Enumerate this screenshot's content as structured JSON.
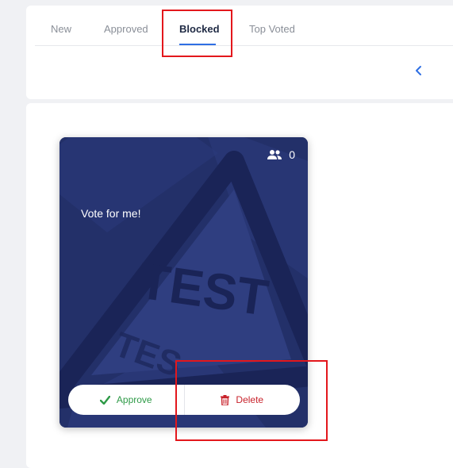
{
  "tabs": [
    {
      "label": "New"
    },
    {
      "label": "Approved"
    },
    {
      "label": "Blocked",
      "active": true
    },
    {
      "label": "Top Voted"
    }
  ],
  "pager": {
    "prev_icon": "chevron-left-icon"
  },
  "card": {
    "voter_count": "0",
    "voter_icon": "people-icon",
    "title": "Vote for me!",
    "image_text": "TEST",
    "approve_label": "Approve",
    "delete_label": "Delete"
  },
  "colors": {
    "accent": "#2f6fe4",
    "approve": "#2e9a47",
    "delete": "#c8222b",
    "card_bg": "#233069",
    "highlight": "#e3171c"
  }
}
